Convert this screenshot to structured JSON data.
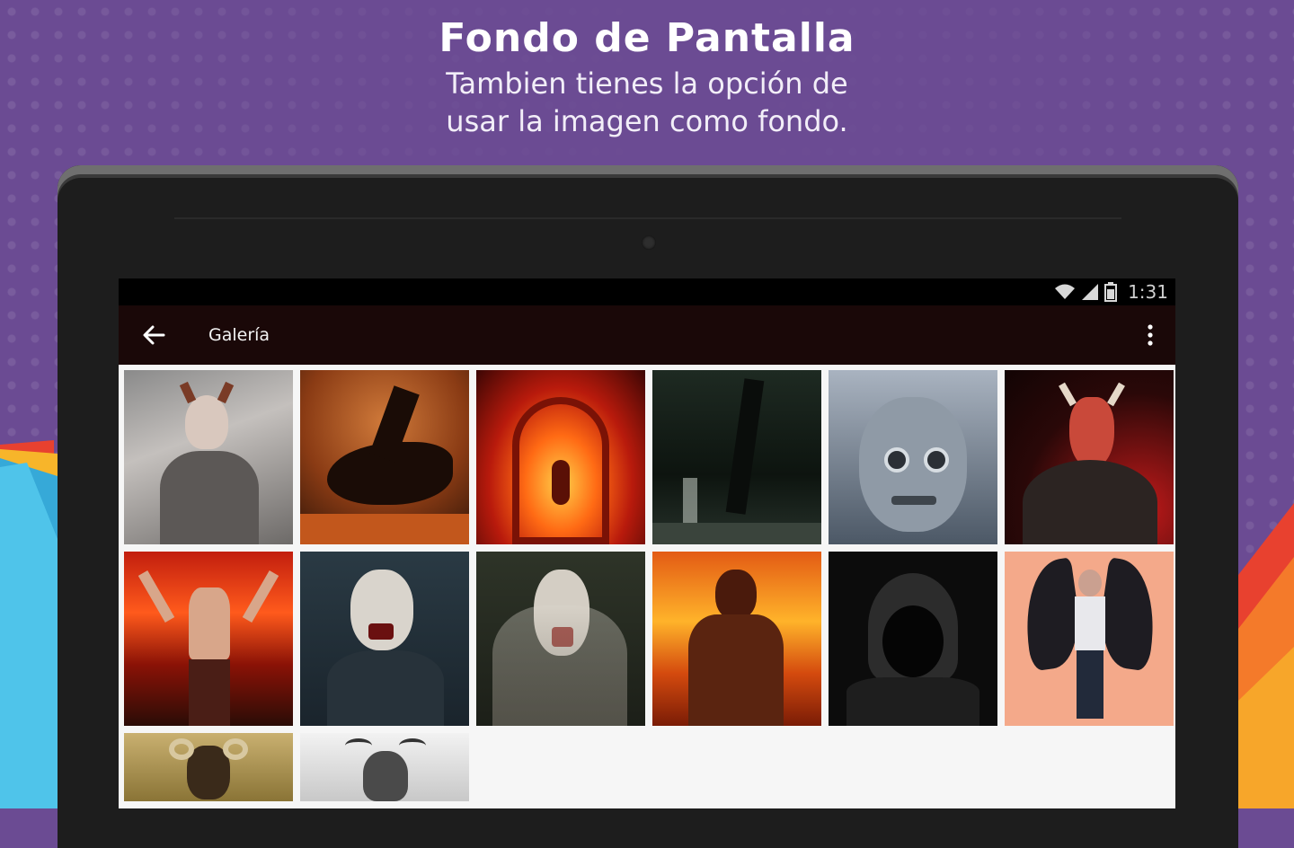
{
  "promo": {
    "title": "Fondo de Pantalla",
    "subtitle_line1": "Tambien tienes la opción de",
    "subtitle_line2": "usar la imagen como fondo."
  },
  "status_bar": {
    "time": "1:31",
    "icons": [
      "wifi-icon",
      "signal-icon",
      "battery-icon"
    ]
  },
  "app_bar": {
    "title": "Galería",
    "back_icon": "arrow-left-icon",
    "menu_icon": "more-vert-icon"
  },
  "gallery": {
    "thumbnails": [
      "horned-woman",
      "dark-dragon",
      "red-hell-gate",
      "dark-forest-demon",
      "stone-gargoyle",
      "red-horned-demon",
      "man-red-sky",
      "pale-ghoul",
      "white-haired-ghoul",
      "fire-demon",
      "hooded-figure",
      "winged-demon-woman",
      "ram-skull-demon",
      "horned-skull-sketch"
    ]
  },
  "colors": {
    "background": "#6b4b93",
    "app_bar": "#1a0808",
    "status_bar": "#000000",
    "tablet_bezel": "#1d1d1d"
  }
}
